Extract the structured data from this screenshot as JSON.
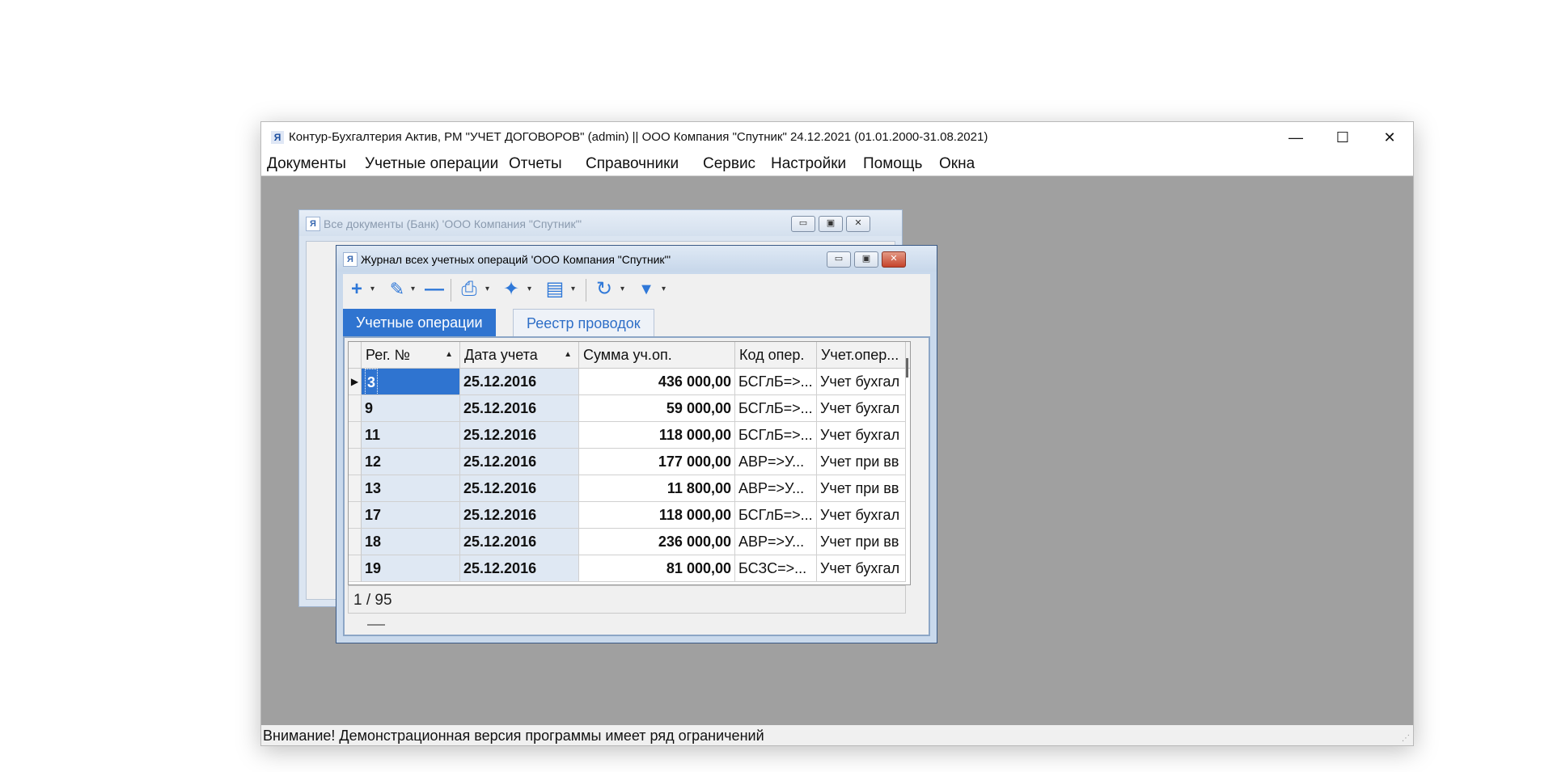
{
  "app": {
    "icon_glyph": "Я",
    "title": "Контур-Бухгалтерия Актив, РМ \"УЧЕТ ДОГОВОРОВ\" (admin) || ООО Компания \"Спутник\" 24.12.2021 (01.01.2000-31.08.2021)",
    "controls": {
      "minimize": "—",
      "maximize": "☐",
      "close": "✕"
    }
  },
  "menu": [
    "Документы",
    "Учетные операции",
    "Отчеты",
    "Справочники",
    "Сервис",
    "Настройки",
    "Помощь",
    "Окна"
  ],
  "back_window": {
    "title": "Все документы (Банк)  'ООО Компания \"Спутник\"'",
    "controls": {
      "minimize": "▭",
      "maximize": "▣",
      "close": "✕"
    }
  },
  "journal": {
    "title": "Журнал всех учетных операций  'ООО Компания \"Спутник\"'",
    "controls": {
      "minimize": "▭",
      "maximize": "▣",
      "close": "✕"
    },
    "toolbar": {
      "add": "+",
      "edit": "✎",
      "remove": "—",
      "print": "⎙",
      "wizard": "✦",
      "document": "▤",
      "refresh": "↻",
      "filter": "▼",
      "dropdown": "▾"
    },
    "tabs": [
      "Учетные операции",
      "Реестр проводок"
    ],
    "columns": [
      "Рег. №",
      "Дата учета",
      "Сумма уч.оп.",
      "Код опер.",
      "Учет.опер..."
    ],
    "sort_arrow": "▲",
    "rows": [
      {
        "reg": "3",
        "date": "25.12.2016",
        "sum": "436 000,00",
        "code": "БСГлБ=>...",
        "acc": "Учет бухгал"
      },
      {
        "reg": "9",
        "date": "25.12.2016",
        "sum": "59 000,00",
        "code": "БСГлБ=>...",
        "acc": "Учет бухгал"
      },
      {
        "reg": "11",
        "date": "25.12.2016",
        "sum": "118 000,00",
        "code": "БСГлБ=>...",
        "acc": "Учет бухгал"
      },
      {
        "reg": "12",
        "date": "25.12.2016",
        "sum": "177 000,00",
        "code": "АВР=>У...",
        "acc": "Учет при вв"
      },
      {
        "reg": "13",
        "date": "25.12.2016",
        "sum": "11 800,00",
        "code": "АВР=>У...",
        "acc": "Учет при вв"
      },
      {
        "reg": "17",
        "date": "25.12.2016",
        "sum": "118 000,00",
        "code": "БСГлБ=>...",
        "acc": "Учет бухгал"
      },
      {
        "reg": "18",
        "date": "25.12.2016",
        "sum": "236 000,00",
        "code": "АВР=>У...",
        "acc": "Учет при вв"
      },
      {
        "reg": "19",
        "date": "25.12.2016",
        "sum": "81 000,00",
        "code": "БСЗС=>...",
        "acc": "Учет бухгал"
      }
    ],
    "current_row_marker": "▶",
    "record_counter": "1 / 95"
  },
  "status": "Внимание! Демонстрационная версия программы имеет ряд ограничений",
  "colors": {
    "accent": "#2f74d0",
    "workspace": "#a0a0a0",
    "selected_col": "#dfe8f3"
  }
}
